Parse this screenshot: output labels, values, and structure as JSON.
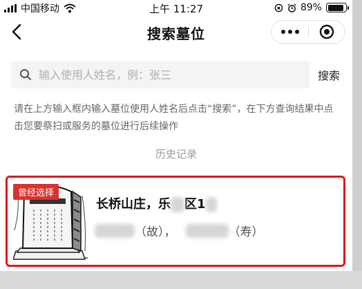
{
  "status_bar": {
    "carrier": "中国移动",
    "time": "上午 11:27",
    "battery": "89%",
    "battery_level": 0.89
  },
  "nav": {
    "title": "搜索墓位",
    "back_icon": "chevron-left-icon",
    "more_icon": "more-dots-icon",
    "close_icon": "target-circle-icon"
  },
  "search": {
    "placeholder": "输入使用人姓名，例：张三",
    "value": "",
    "button_label": "搜索"
  },
  "hint": "请在上方输入框内输入墓位使用人姓名后点击“搜索”，在下方查询结果中点击您要祭扫或服务的墓位进行后续操作",
  "history": {
    "title": "历史记录",
    "items": [
      {
        "tag": "曾经选择",
        "title_prefix": "长桥山庄，乐",
        "title_mid": "区1",
        "status_1": "（故），",
        "status_2": "（寿）"
      }
    ]
  },
  "colors": {
    "accent": "#e0161b",
    "tag": "#d9322f",
    "hint_text": "#666666",
    "search_bg": "#f4f4f4"
  }
}
